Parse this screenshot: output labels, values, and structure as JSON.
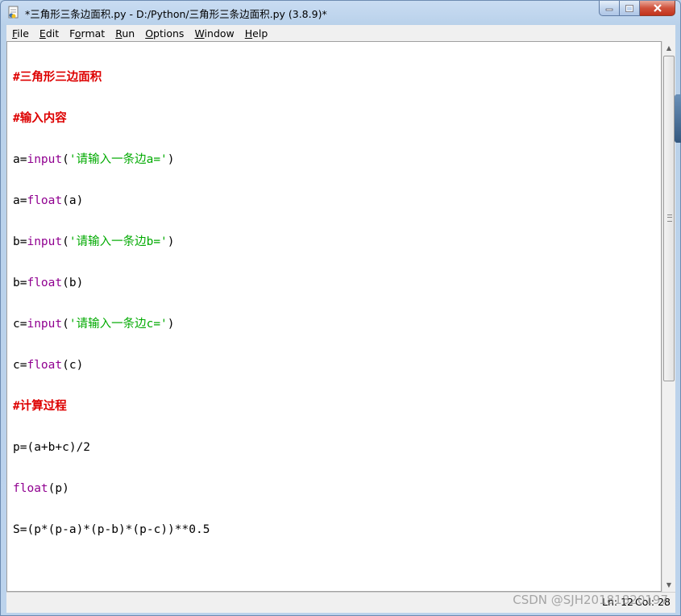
{
  "window": {
    "title": "*三角形三条边面积.py - D:/Python/三角形三条边面积.py (3.8.9)*"
  },
  "menu": [
    {
      "accel": "F",
      "rest": "ile"
    },
    {
      "accel": "E",
      "rest": "dit"
    },
    {
      "accel": "",
      "pre": "F",
      "accel2": "o",
      "rest": "rmat"
    },
    {
      "accel": "R",
      "rest": "un"
    },
    {
      "accel": "O",
      "rest": "ptions"
    },
    {
      "accel": "W",
      "rest": "indow"
    },
    {
      "accel": "H",
      "rest": "elp"
    }
  ],
  "menu_labels": {
    "file": {
      "u": "F",
      "t": "ile"
    },
    "edit": {
      "u": "E",
      "t": "dit"
    },
    "format_pre": "F",
    "format_u": "o",
    "format_t": "rmat",
    "run": {
      "u": "R",
      "t": "un"
    },
    "options": {
      "u": "O",
      "t": "ptions"
    },
    "window": {
      "u": "W",
      "t": "indow"
    },
    "help": {
      "u": "H",
      "t": "elp"
    }
  },
  "code": {
    "l1": "#三角形三边面积",
    "l2": "#输入内容",
    "l3_a": "a=",
    "l3_b": "input",
    "l3_c": "(",
    "l3_d": "'请输入一条边a='",
    "l3_e": ")",
    "l4_a": "a=",
    "l4_b": "float",
    "l4_c": "(a)",
    "l5_a": "b=",
    "l5_b": "input",
    "l5_c": "(",
    "l5_d": "'请输入一条边b='",
    "l5_e": ")",
    "l6_a": "b=",
    "l6_b": "float",
    "l6_c": "(b)",
    "l7_a": "c=",
    "l7_b": "input",
    "l7_c": "(",
    "l7_d": "'请输入一条边c='",
    "l7_e": ")",
    "l8_a": "c=",
    "l8_b": "float",
    "l8_c": "(c)",
    "l9": "#计算过程",
    "l10": "p=(a+b+c)/2",
    "l11_a": "float",
    "l11_b": "(p)",
    "l12": "S=(p*(p-a)*(p-b)*(p-c))**0.5"
  },
  "status": {
    "ln": "Ln: 12",
    "col": "Col: 28"
  },
  "watermark": "CSDN @SJH20181820197"
}
